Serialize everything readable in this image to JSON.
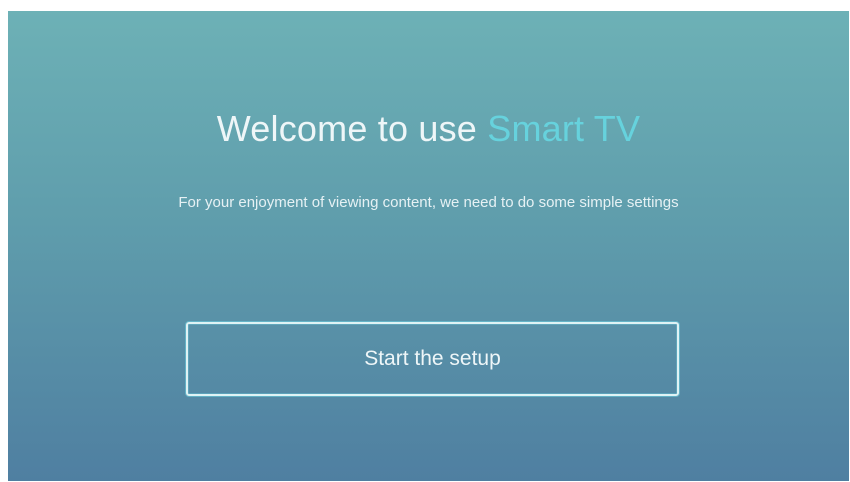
{
  "welcome": {
    "prefix": "Welcome to use ",
    "brand": "Smart TV"
  },
  "subtitle": "For your enjoyment of viewing content, we need to do some simple settings",
  "setup_button": {
    "label": "Start the setup"
  },
  "colors": {
    "background_top": "#6db1b6",
    "background_bottom": "#4f7fa1",
    "brand_accent": "#66d2dd",
    "text": "#eef6f8"
  }
}
